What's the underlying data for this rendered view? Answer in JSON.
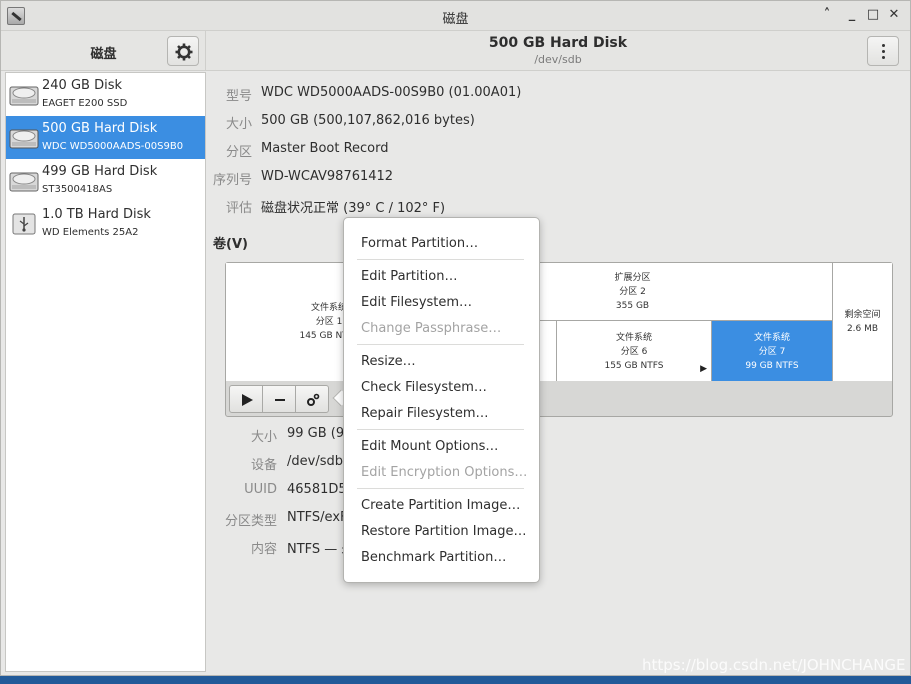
{
  "window": {
    "title": "磁盘"
  },
  "sidebar": {
    "title": "磁盘",
    "disks": [
      {
        "name": "240 GB Disk",
        "model": "EAGET E200 SSD",
        "selected": false,
        "icon": "hard-disk-icon"
      },
      {
        "name": "500 GB Hard Disk",
        "model": "WDC WD5000AADS-00S9B0",
        "selected": true,
        "icon": "hard-disk-icon"
      },
      {
        "name": "499 GB Hard Disk",
        "model": "ST3500418AS",
        "selected": false,
        "icon": "hard-disk-icon"
      },
      {
        "name": "1.0 TB Hard Disk",
        "model": "WD Elements 25A2",
        "selected": false,
        "icon": "usb-disk-icon"
      }
    ]
  },
  "header": {
    "title": "500 GB Hard Disk",
    "subtitle": "/dev/sdb"
  },
  "disk_info": [
    {
      "label": "型号",
      "value": "WDC WD5000AADS-00S9B0 (01.00A01)"
    },
    {
      "label": "大小",
      "value": "500 GB (500,107,862,016 bytes)"
    },
    {
      "label": "分区",
      "value": "Master Boot Record"
    },
    {
      "label": "序列号",
      "value": "WD-WCAV98761412"
    },
    {
      "label": "评估",
      "value": "磁盘状况正常 (39° C / 102° F)"
    }
  ],
  "volumes": {
    "heading": "卷(V)",
    "partitions": {
      "p1": {
        "line1": "文件系统",
        "line2": "分区 1",
        "line3": "145 GB NTFS"
      },
      "extended": {
        "line1": "扩展分区",
        "line2": "分区 2",
        "line3": "355 GB"
      },
      "p6": {
        "line1": "文件系统",
        "line2": "分区 6",
        "line3": "155 GB NTFS"
      },
      "p7": {
        "line1": "文件系统",
        "line2": "分区 7",
        "line3": "99 GB NTFS"
      },
      "free": {
        "line1": "剩余空间",
        "line2": "2.6 MB"
      }
    }
  },
  "volume_info": [
    {
      "label": "大小",
      "value": "99 GB (99"
    },
    {
      "label": "设备",
      "value": "/dev/sdb7"
    },
    {
      "label": "UUID",
      "value": "46581D54"
    },
    {
      "label": "分区类型",
      "value": "NTFS/exF"
    },
    {
      "label": "内容",
      "value": "NTFS — 未"
    }
  ],
  "context_menu": {
    "items": [
      {
        "label": "Format Partition…",
        "enabled": true
      },
      {
        "label": "Edit Partition…",
        "enabled": true
      },
      {
        "label": "Edit Filesystem…",
        "enabled": true
      },
      {
        "label": "Change Passphrase…",
        "enabled": false
      },
      {
        "label": "Resize…",
        "enabled": true
      },
      {
        "label": "Check Filesystem…",
        "enabled": true
      },
      {
        "label": "Repair Filesystem…",
        "enabled": true
      },
      {
        "label": "Edit Mount Options…",
        "enabled": true
      },
      {
        "label": "Edit Encryption Options…",
        "enabled": false
      },
      {
        "label": "Create Partition Image…",
        "enabled": true
      },
      {
        "label": "Restore Partition Image…",
        "enabled": true
      },
      {
        "label": "Benchmark Partition…",
        "enabled": true
      }
    ]
  },
  "watermark": "https://blog.csdn.net/JOHNCHANGE",
  "colors": {
    "selection": "#3b8ee2",
    "window_bg": "#e8e8e7"
  }
}
